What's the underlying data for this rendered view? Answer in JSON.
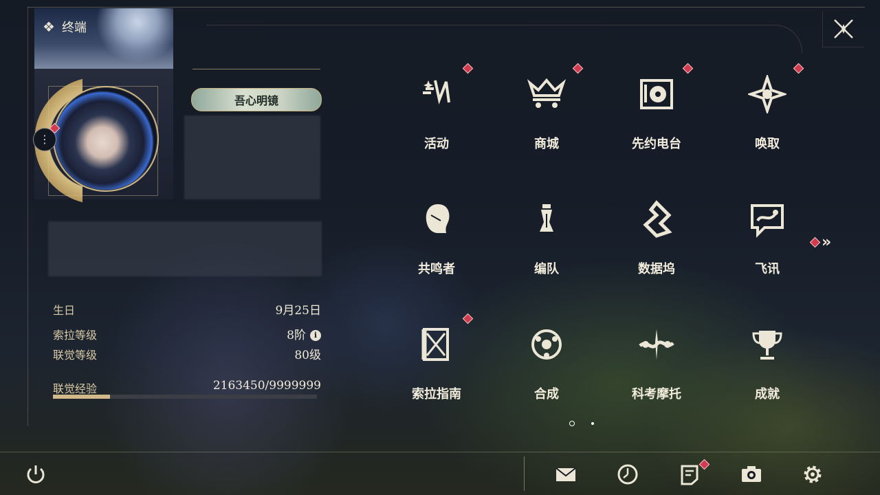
{
  "header": {
    "title": "终端",
    "close_icon": "close-icon"
  },
  "profile": {
    "title_plate": "吾心明镜",
    "birthday_label": "生日",
    "birthday_value": "9月25日",
    "sola_level_label": "索拉等级",
    "sola_level_value": "8阶",
    "union_level_label": "联觉等级",
    "union_level_value": "80级",
    "union_exp_label": "联觉经验",
    "union_exp_value": "2163450/9999999",
    "union_exp_fraction": 0.2163
  },
  "menu": [
    {
      "label": "活动",
      "icon": "event-icon",
      "badge": true
    },
    {
      "label": "商城",
      "icon": "shop-crown-cart-icon",
      "badge": true
    },
    {
      "label": "先约电台",
      "icon": "radio-icon",
      "badge": true
    },
    {
      "label": "唤取",
      "icon": "compass-summon-icon",
      "badge": true
    },
    {
      "label": "共鸣者",
      "icon": "resonator-head-icon",
      "badge": false
    },
    {
      "label": "编队",
      "icon": "chess-team-icon",
      "badge": false
    },
    {
      "label": "数据坞",
      "icon": "data-dock-icon",
      "badge": false
    },
    {
      "label": "飞讯",
      "icon": "message-chat-icon",
      "badge": false
    },
    {
      "label": "索拉指南",
      "icon": "guide-book-icon",
      "badge": true
    },
    {
      "label": "合成",
      "icon": "synthesis-icon",
      "badge": false
    },
    {
      "label": "科考摩托",
      "icon": "motorbike-icon",
      "badge": false
    },
    {
      "label": "成就",
      "icon": "trophy-icon",
      "badge": false
    }
  ],
  "pagination": {
    "current": 1,
    "total": 2
  },
  "bottom_bar": {
    "power_icon": "power-icon",
    "mail_icon": "mail-icon",
    "clock_icon": "clock-icon",
    "notice_icon": "notice-icon",
    "camera_icon": "camera-icon",
    "settings_icon": "gear-icon"
  },
  "colors": {
    "accent_gold": "#d2b98a",
    "badge_red": "#d23b4d"
  }
}
